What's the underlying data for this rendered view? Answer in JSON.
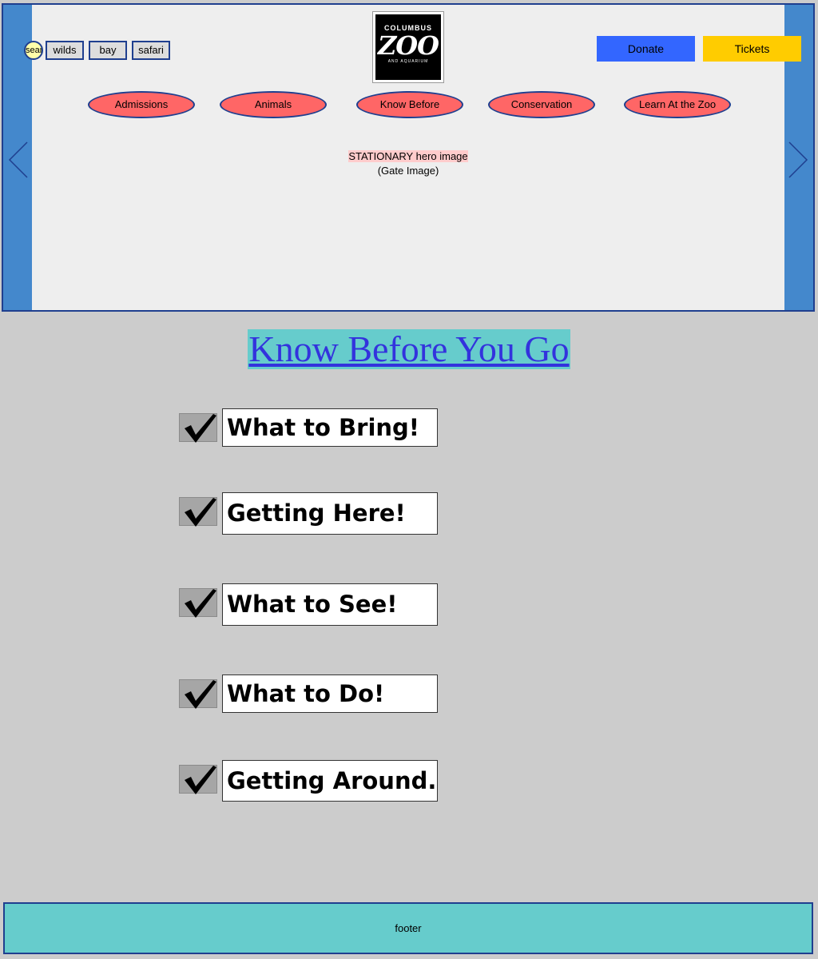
{
  "header": {
    "search_label": "search",
    "zones": [
      "wilds",
      "bay",
      "safari"
    ],
    "logo": {
      "line1": "COLUMBUS",
      "line2": "ZOO",
      "line3": "AND AQUARIUM"
    },
    "donate_label": "Donate",
    "tickets_label": "Tickets",
    "nav": [
      "Admissions",
      "Animals",
      "Know Before",
      "Conservation",
      "Learn At the Zoo"
    ],
    "hero_title": "STATIONARY hero image",
    "hero_subtitle": "(Gate Image)",
    "icons": {
      "left": "chevron-left-icon",
      "right": "chevron-right-icon"
    }
  },
  "main": {
    "title": "Know Before You Go",
    "items": [
      "What to Bring!",
      "Getting Here!",
      "What to See!",
      "What to Do!",
      "Getting Around..."
    ],
    "item_icon": "checkmark-icon"
  },
  "footer": {
    "label": "footer"
  },
  "colors": {
    "page_bg": "#cccccc",
    "hero_bg": "#eeeeee",
    "side_bar": "#4488cc",
    "border": "#1f3f8f",
    "nav_pill": "#ff6666",
    "donate": "#3366ff",
    "tickets": "#ffcc00",
    "title_bg": "#66cccc",
    "title_link": "#3333dd",
    "footer_bg": "#66cccc"
  }
}
